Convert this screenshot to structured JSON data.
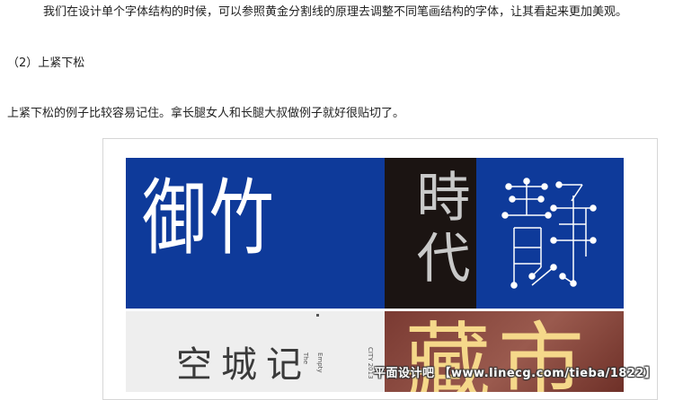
{
  "paragraphs": {
    "intro": "我们在设计单个字体结构的时候，可以参照黄金分割线的原理去调整不同笔画结构的字体，让其看起来更加美观。",
    "heading": "（2）上紧下松",
    "example": "上紧下松的例子比较容易记住。拿长腿女人和长腿大叔做例子就好很贴切了。"
  },
  "image": {
    "panel1_text": "御竹",
    "panel2_text": "時代",
    "panel3_text": "静",
    "panel4_text": "空城记",
    "panel4_small_en1": "The",
    "panel4_small_en2": "Empty",
    "panel4_small_en3": "CITY 2013",
    "panel5_text": "藏市",
    "watermark": "平面设计吧 【www.linecg.com/tieba/1822】"
  },
  "colors": {
    "blue": "#0e3a9a",
    "dark": "#1b1412",
    "gray": "#eeeeee",
    "brown": "#7a3a32",
    "gold": "#f5d88a"
  }
}
